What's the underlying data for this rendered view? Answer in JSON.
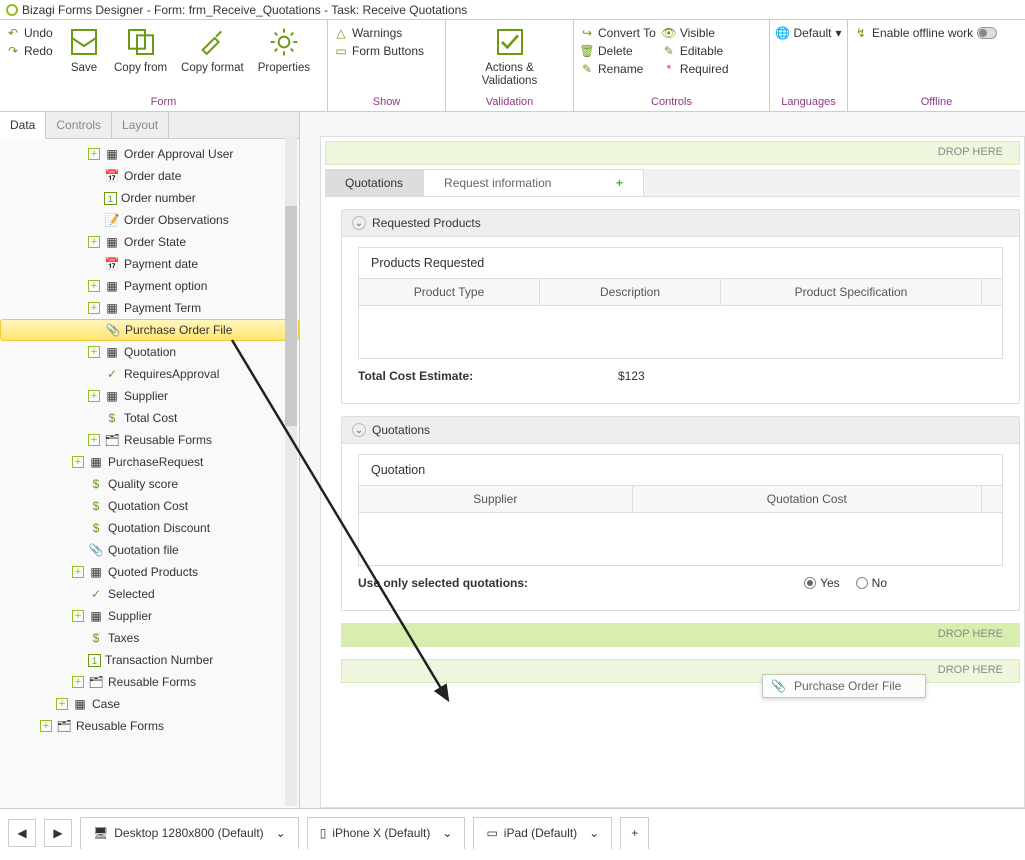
{
  "title": "Bizagi Forms Designer  - Form:  frm_Receive_Quotations - Task:  Receive Quotations",
  "ribbon": {
    "undo": "Undo",
    "redo": "Redo",
    "save": "Save",
    "copy_from": "Copy from",
    "copy_format": "Copy format",
    "properties": "Properties",
    "group_form": "Form",
    "warnings": "Warnings",
    "form_buttons": "Form Buttons",
    "group_show": "Show",
    "actions": "Actions & Validations",
    "group_validation": "Validation",
    "convert": "Convert To",
    "delete": "Delete",
    "rename": "Rename",
    "visible": "Visible",
    "editable": "Editable",
    "required": "Required",
    "group_controls": "Controls",
    "default_lang": "Default",
    "group_languages": "Languages",
    "offline": "Enable offline work",
    "group_offline": "Offline"
  },
  "sidetabs": {
    "data": "Data",
    "controls": "Controls",
    "layout": "Layout"
  },
  "tree": [
    {
      "indent": 3,
      "icons": [
        "plus",
        "doc"
      ],
      "label": "Order Approval User"
    },
    {
      "indent": 3,
      "icons": [
        "date"
      ],
      "label": "Order date"
    },
    {
      "indent": 3,
      "icons": [
        "num"
      ],
      "label": "Order number"
    },
    {
      "indent": 3,
      "icons": [
        "text"
      ],
      "label": "Order Observations"
    },
    {
      "indent": 3,
      "icons": [
        "plus",
        "doc"
      ],
      "label": "Order State"
    },
    {
      "indent": 3,
      "icons": [
        "date"
      ],
      "label": "Payment date"
    },
    {
      "indent": 3,
      "icons": [
        "plus",
        "doc"
      ],
      "label": "Payment option"
    },
    {
      "indent": 3,
      "icons": [
        "plus",
        "doc"
      ],
      "label": "Payment Term"
    },
    {
      "indent": 3,
      "icons": [
        "attach"
      ],
      "label": "Purchase Order File",
      "highlight": true
    },
    {
      "indent": 3,
      "icons": [
        "plus",
        "doc"
      ],
      "label": "Quotation"
    },
    {
      "indent": 3,
      "icons": [
        "check"
      ],
      "label": "RequiresApproval"
    },
    {
      "indent": 3,
      "icons": [
        "plus",
        "doc"
      ],
      "label": "Supplier"
    },
    {
      "indent": 3,
      "icons": [
        "coin"
      ],
      "label": "Total Cost"
    },
    {
      "indent": 3,
      "icons": [
        "plus",
        "forms"
      ],
      "label": "Reusable Forms"
    },
    {
      "indent": 2,
      "icons": [
        "plus",
        "doc"
      ],
      "label": "PurchaseRequest"
    },
    {
      "indent": 2,
      "icons": [
        "coin"
      ],
      "label": "Quality score"
    },
    {
      "indent": 2,
      "icons": [
        "coin"
      ],
      "label": "Quotation Cost"
    },
    {
      "indent": 2,
      "icons": [
        "coin"
      ],
      "label": "Quotation Discount"
    },
    {
      "indent": 2,
      "icons": [
        "attach"
      ],
      "label": "Quotation file"
    },
    {
      "indent": 2,
      "icons": [
        "plus",
        "grid"
      ],
      "label": "Quoted Products"
    },
    {
      "indent": 2,
      "icons": [
        "check"
      ],
      "label": "Selected"
    },
    {
      "indent": 2,
      "icons": [
        "plus",
        "doc"
      ],
      "label": "Supplier"
    },
    {
      "indent": 2,
      "icons": [
        "coin"
      ],
      "label": "Taxes"
    },
    {
      "indent": 2,
      "icons": [
        "num"
      ],
      "label": "Transaction Number"
    },
    {
      "indent": 2,
      "icons": [
        "plus",
        "forms"
      ],
      "label": "Reusable Forms"
    },
    {
      "indent": 1,
      "icons": [
        "plus",
        "doc"
      ],
      "label": "Case"
    },
    {
      "indent": 0,
      "icons": [
        "plus",
        "forms"
      ],
      "label": "Reusable Forms"
    }
  ],
  "canvas": {
    "drop_here": "DROP HERE",
    "tabs": {
      "active": "Quotations",
      "other": "Request information"
    },
    "panel1": {
      "title": "Requested Products",
      "sub_title": "Products Requested",
      "cols": [
        "Product Type",
        "Description",
        "Product Specification"
      ],
      "total_label": "Total Cost Estimate:",
      "total_val": "$123"
    },
    "panel2": {
      "title": "Quotations",
      "sub_title": "Quotation",
      "cols": [
        "Supplier",
        "Quotation Cost"
      ],
      "use_only": "Use only selected quotations:",
      "yes": "Yes",
      "no": "No"
    },
    "dragged": "Purchase Order File"
  },
  "bottom": {
    "desktop": "Desktop 1280x800 (Default)",
    "iphone": "iPhone X (Default)",
    "ipad": "iPad (Default)"
  }
}
